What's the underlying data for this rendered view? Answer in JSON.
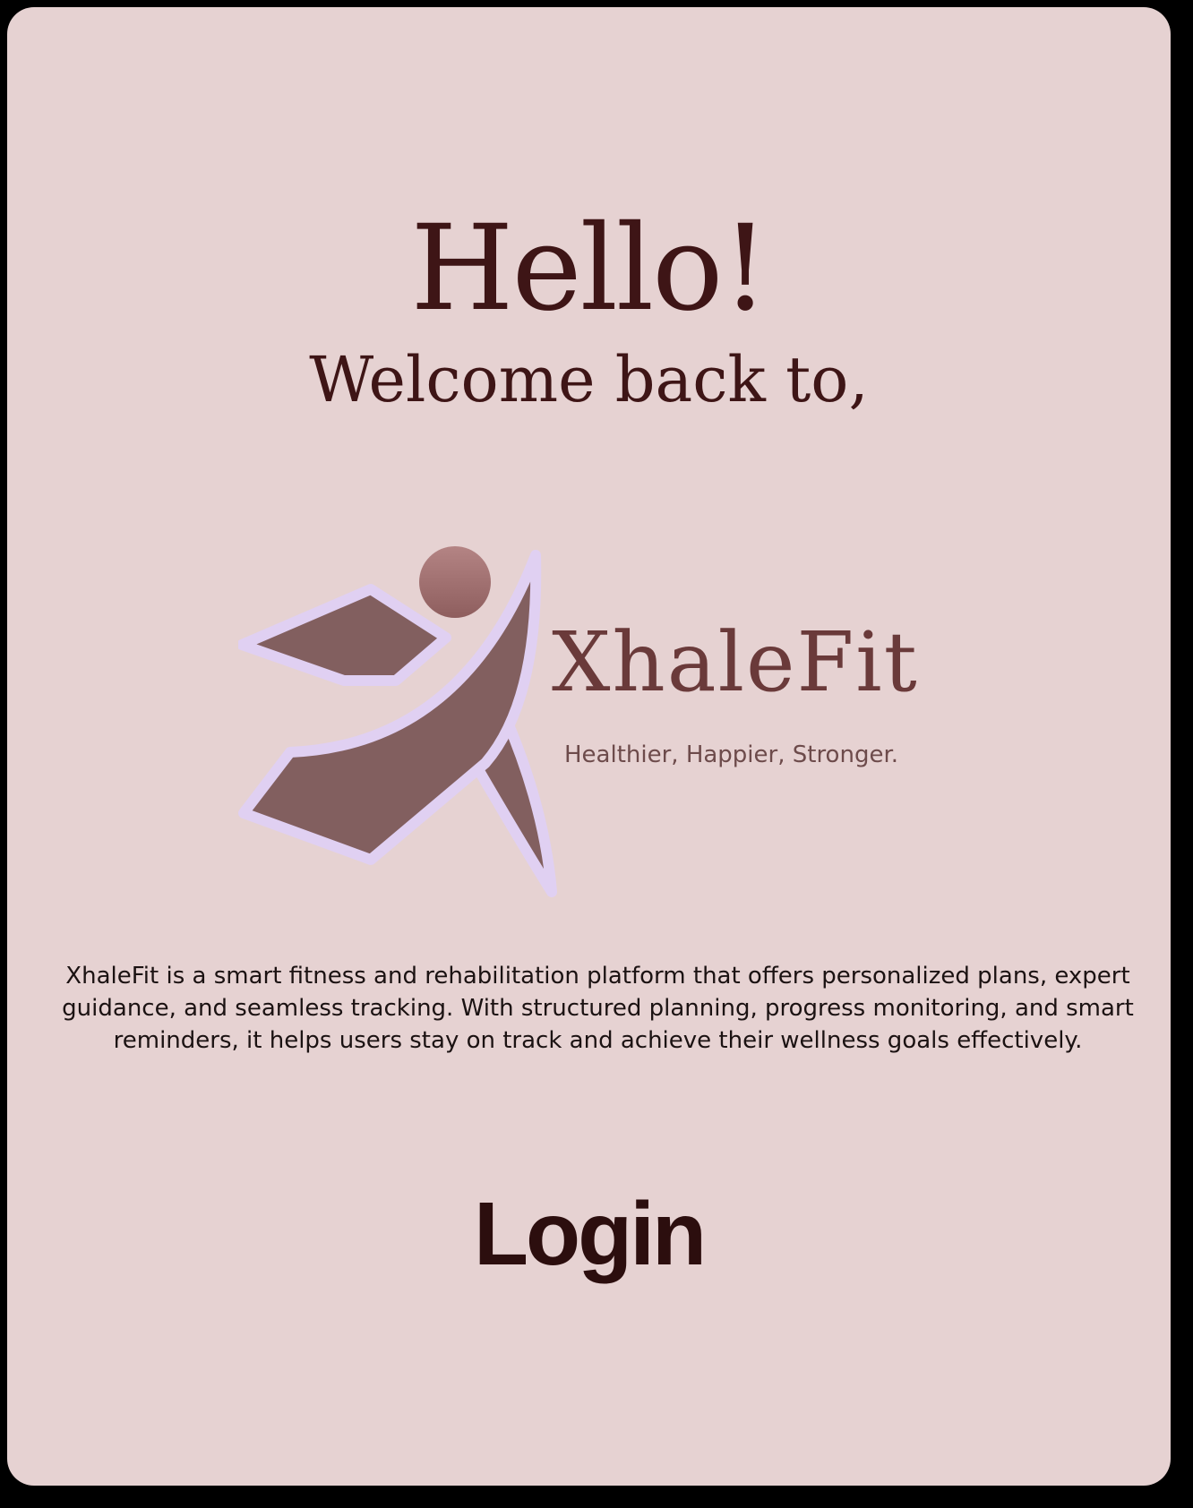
{
  "header": {
    "greeting": "Hello!",
    "welcome": "Welcome back  to,"
  },
  "brand": {
    "name": "XhaleFit",
    "tagline": "Healthier,  Happier,  Stronger.",
    "logo_icon": "xhalefit-figure-logo"
  },
  "description": "XhaleFit is a smart fitness and rehabilitation platform that offers personalized plans, expert guidance, and seamless tracking. With structured planning, progress monitoring, and smart reminders, it helps users stay on track and achieve their wellness goals effectively.",
  "actions": {
    "login_label": "Login"
  },
  "colors": {
    "background": "#e6d2d2",
    "frame": "#000000",
    "text_dark": "#3e1516",
    "logo_fill": "#825f5f",
    "logo_outline": "#e0d0f2",
    "logo_head": "#9e6e6e"
  }
}
